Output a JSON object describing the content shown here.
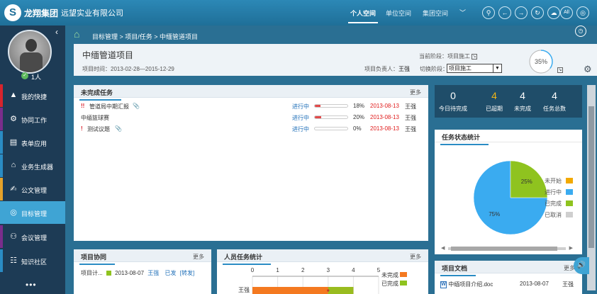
{
  "header": {
    "brand": "龙翔集团",
    "company": "远望实业有限公司",
    "tabs": [
      "个人空间",
      "单位空间",
      "集团空间"
    ],
    "tab_more": "﹀",
    "icons": [
      "search-icon",
      "back-icon",
      "forward-icon",
      "refresh-icon",
      "cloud-icon",
      "all-icon",
      "help-icon"
    ],
    "all_label": "All"
  },
  "sidebar": {
    "online_count": "1人",
    "items": [
      {
        "label": "我的快捷",
        "icon": "shortcut-icon",
        "accent": "#d7242d"
      },
      {
        "label": "协同工作",
        "icon": "collaborate-icon",
        "accent": "#7a2d8c"
      },
      {
        "label": "表单应用",
        "icon": "form-icon",
        "accent": "#2a8cc4"
      },
      {
        "label": "业务生成器",
        "icon": "business-icon",
        "accent": "#2a8cc4"
      },
      {
        "label": "公文管理",
        "icon": "document-icon",
        "accent": "#e4a22a"
      },
      {
        "label": "目标管理",
        "icon": "target-icon",
        "accent": "#3fa4d4"
      },
      {
        "label": "会议管理",
        "icon": "meeting-icon",
        "accent": "#7a2d8c"
      },
      {
        "label": "知识社区",
        "icon": "knowledge-icon",
        "accent": "#2a8cc4"
      }
    ],
    "more": "•••"
  },
  "breadcrumb": {
    "path": "目标管理 > 项目/任务 > 中缅管道项目"
  },
  "project": {
    "title": "中缅管道项目",
    "period_label": "项目时间：",
    "period": "2013-02-28—2015-12-29",
    "current_stage_label": "当前阶段：",
    "current_stage": "项目施工",
    "leader_label": "项目负责人：",
    "leader": "王强",
    "switch_label": "切换阶段：",
    "switch_value": "项目施工",
    "progress": "35%",
    "progress_value": 35
  },
  "tasks_panel": {
    "title": "未完成任务",
    "more": "更多",
    "rows": [
      {
        "flag": "!!",
        "name": "管道局中期汇报",
        "attach": true,
        "status": "进行中",
        "percent": "18%",
        "percent_value": 18,
        "date": "2013-08-13",
        "owner": "王强"
      },
      {
        "flag": "",
        "name": "中缅篮球赛",
        "attach": false,
        "status": "进行中",
        "percent": "20%",
        "percent_value": 20,
        "date": "2013-08-13",
        "owner": "王强"
      },
      {
        "flag": "!",
        "name": "测试议题",
        "attach": true,
        "status": "进行中",
        "percent": "0%",
        "percent_value": 0,
        "date": "2013-08-13",
        "owner": "王强"
      }
    ]
  },
  "stats": [
    {
      "value": "0",
      "label": "今日待完成"
    },
    {
      "value": "4",
      "label": "已超期"
    },
    {
      "value": "4",
      "label": "未完成"
    },
    {
      "value": "4",
      "label": "任务总数"
    }
  ],
  "status_panel": {
    "title": "任务状态统计"
  },
  "chart_data": [
    {
      "type": "pie",
      "title": "任务状态统计",
      "categories": [
        "未开始",
        "进行中",
        "已完成",
        "已取消"
      ],
      "values": [
        0,
        75,
        25,
        0
      ],
      "data_labels": [
        "",
        "75%",
        "25%",
        ""
      ],
      "colors": [
        "#f2a900",
        "#3aabf0",
        "#8fc31f",
        "#cfcfcf"
      ],
      "legend": "right"
    },
    {
      "type": "bar",
      "title": "人员任务统计",
      "orientation": "horizontal",
      "categories": [
        "王强"
      ],
      "xlim": [
        0,
        5
      ],
      "xticks": [
        "0",
        "1",
        "2",
        "3",
        "4",
        "5"
      ],
      "series": [
        {
          "name": "未完成",
          "values": [
            4
          ],
          "color": "#f47920"
        },
        {
          "name": "已完成",
          "values": [
            0
          ],
          "color": "#8fc31f"
        }
      ],
      "legend": "right"
    }
  ],
  "collab_panel": {
    "title": "项目协同",
    "more": "更多",
    "row": {
      "name": "项目计...",
      "date": "2013-08-07",
      "owner": "王强",
      "status": "已发",
      "action": "[转发]"
    }
  },
  "person_panel": {
    "title": "人员任务统计",
    "more": "更多"
  },
  "docs_panel": {
    "title": "项目文档",
    "more": "更多",
    "row": {
      "name": "中缅项目介绍.doc",
      "date": "2013-08-07",
      "owner": "王强"
    }
  }
}
